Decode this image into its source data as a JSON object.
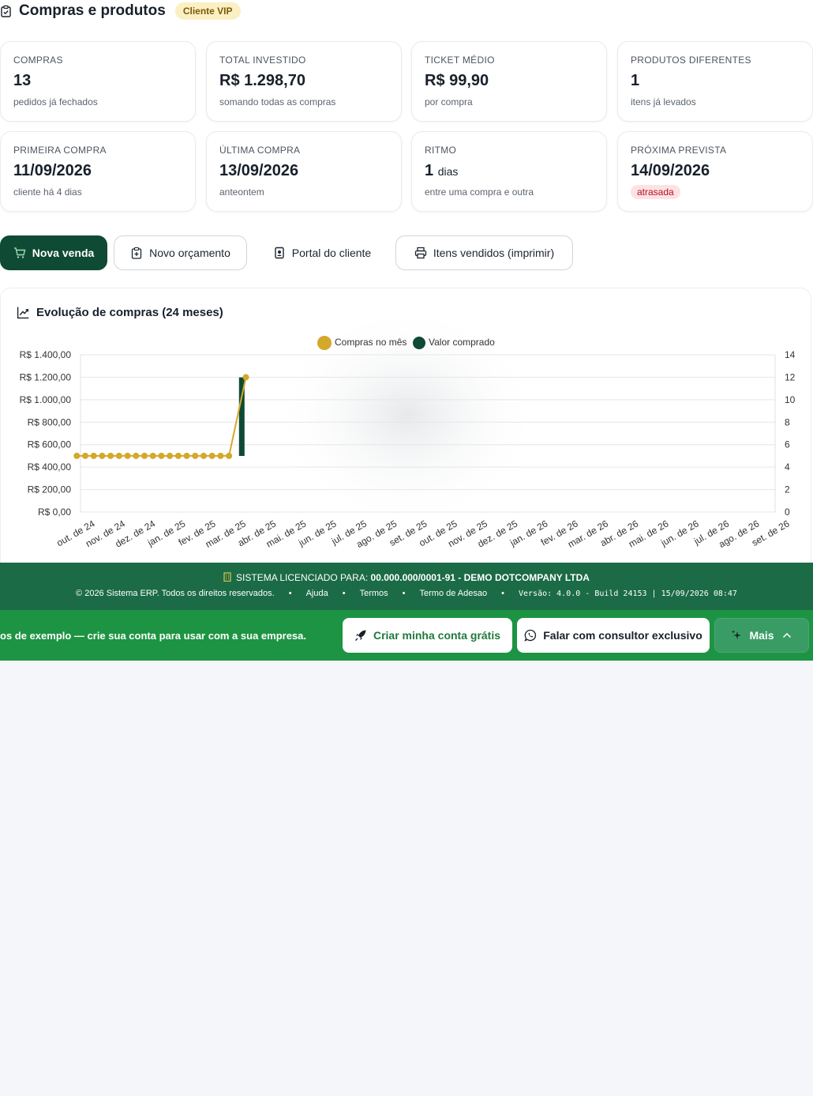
{
  "header": {
    "title": "Compras e produtos",
    "badge": "Cliente VIP"
  },
  "stats": [
    {
      "label": "COMPRAS",
      "value": "13",
      "sub": "pedidos já fechados"
    },
    {
      "label": "TOTAL INVESTIDO",
      "value": "R$ 1.298,70",
      "sub": "somando todas as compras"
    },
    {
      "label": "TICKET MÉDIO",
      "value": "R$ 99,90",
      "sub": "por compra"
    },
    {
      "label": "PRODUTOS DIFERENTES",
      "value": "1",
      "sub": "itens já levados"
    },
    {
      "label": "PRIMEIRA COMPRA",
      "value": "11/09/2026",
      "sub": "cliente há 4 dias"
    },
    {
      "label": "ÚLTIMA COMPRA",
      "value": "13/09/2026",
      "sub": "anteontem"
    },
    {
      "label": "RITMO",
      "value": "1",
      "unit": "dias",
      "sub": "entre uma compra e outra"
    },
    {
      "label": "PRÓXIMA PREVISTA",
      "value": "14/09/2026",
      "badge": "atrasada"
    }
  ],
  "actions": {
    "new_sale": "Nova venda",
    "new_quote": "Novo orçamento",
    "client_portal": "Portal do cliente",
    "print_items": "Itens vendidos (imprimir)"
  },
  "chart_card": {
    "title": "Evolução de compras (24 meses)"
  },
  "chart_data": {
    "type": "bar",
    "title": "",
    "categories": [
      "out. de 24",
      "nov. de 24",
      "dez. de 24",
      "jan. de 25",
      "fev. de 25",
      "mar. de 25",
      "abr. de 25",
      "mai. de 25",
      "jun. de 25",
      "jul. de 25",
      "ago. de 25",
      "set. de 25",
      "out. de 25",
      "nov. de 25",
      "dez. de 25",
      "jan. de 26",
      "fev. de 26",
      "mar. de 26",
      "abr. de 26",
      "mai. de 26",
      "jun. de 26",
      "jul. de 26",
      "ago. de 26",
      "set. de 26"
    ],
    "series": [
      {
        "name": "Compras no mês",
        "type": "line",
        "axis": "right",
        "color": "#d4a82a",
        "x": [
          0,
          0.28,
          0.56,
          0.84,
          1.12,
          1.4,
          1.68,
          1.96,
          2.24,
          2.52,
          2.8,
          3.08,
          3.36,
          3.64,
          3.92,
          4.2,
          4.48,
          4.76,
          5.04,
          5.6
        ],
        "values": [
          5,
          5,
          5,
          5,
          5,
          5,
          5,
          5,
          5,
          5,
          5,
          5,
          5,
          5,
          5,
          5,
          5,
          5,
          5,
          12
        ]
      },
      {
        "name": "Valor comprado",
        "type": "bar",
        "axis": "left",
        "color": "#0f4a34",
        "category": "mar. de 25",
        "range": [
          499.5,
          1198.8
        ]
      }
    ],
    "left_axis": {
      "ticks": [
        "R$ 0,00",
        "R$ 200,00",
        "R$ 400,00",
        "R$ 600,00",
        "R$ 800,00",
        "R$ 1.000,00",
        "R$ 1.200,00",
        "R$ 1.400,00"
      ],
      "ylim": [
        0,
        1400
      ]
    },
    "right_axis": {
      "ticks": [
        "0",
        "2",
        "4",
        "6",
        "8",
        "10",
        "12",
        "14"
      ],
      "ylim": [
        0,
        14
      ]
    },
    "legend": "top-center",
    "grid": true
  },
  "footer": {
    "license_prefix": "SISTEMA LICENCIADO PARA:",
    "license_value": "00.000.000/0001-91 - DEMO DOTCOMPANY LTDA",
    "copyright": "© 2026 Sistema ERP. Todos os direitos reservados.",
    "help": "Ajuda",
    "terms": "Termos",
    "adhesion": "Termo de Adesao",
    "version": "Versão: 4.0.0 - Build 24153 | 15/09/2026 08:47",
    "sep": "•"
  },
  "demo_bar": {
    "text": "os de exemplo — crie sua conta para usar com a sua empresa.",
    "create_account": "Criar minha conta grátis",
    "talk_consultant": "Falar com consultor exclusivo",
    "more": "Mais"
  },
  "colors": {
    "primary": "#0f4a34",
    "accent": "#d4a82a",
    "footer": "#1b6b46",
    "demo": "#1d9443",
    "danger": "#b3121f"
  }
}
